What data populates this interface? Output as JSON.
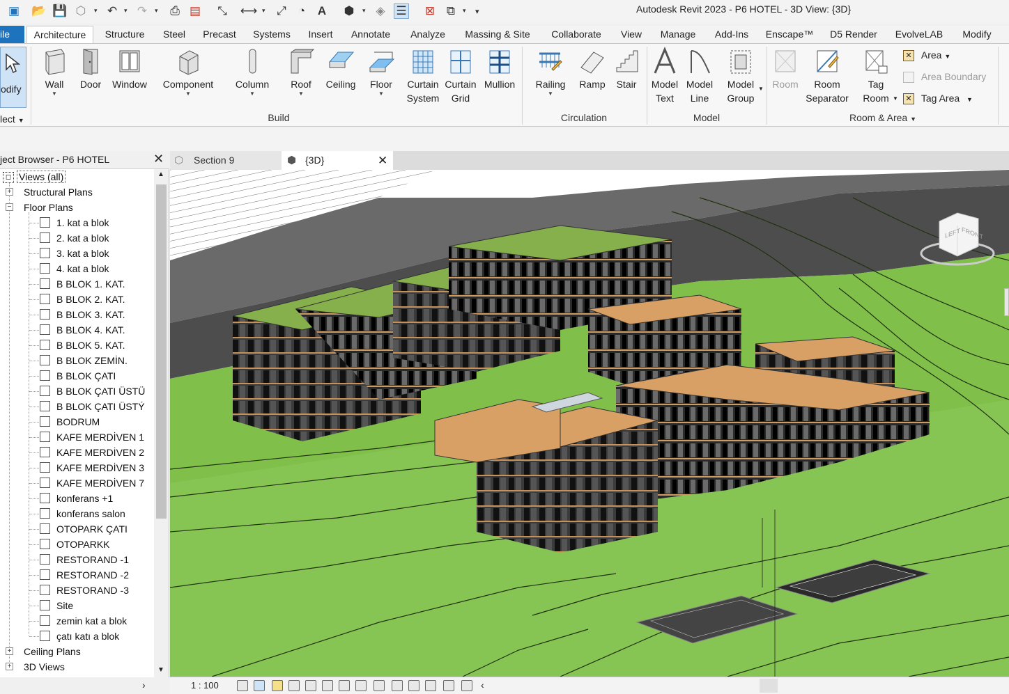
{
  "app": {
    "title": "Autodesk Revit 2023 - P6 HOTEL - 3D View: {3D}"
  },
  "ribbon_tabs": [
    "ile",
    "Architecture",
    "Structure",
    "Steel",
    "Precast",
    "Systems",
    "Insert",
    "Annotate",
    "Analyze",
    "Massing & Site",
    "Collaborate",
    "View",
    "Manage",
    "Add-Ins",
    "Enscape™",
    "D5 Render",
    "EvolveLAB",
    "Modify"
  ],
  "ribbon": {
    "modify_label": "odify",
    "select_label": "lect",
    "build": {
      "title": "Build",
      "wall": "Wall",
      "door": "Door",
      "window": "Window",
      "component": "Component",
      "column": "Column",
      "roof": "Roof",
      "ceiling": "Ceiling",
      "floor": "Floor",
      "curtain_system_1": "Curtain",
      "curtain_system_2": "System",
      "curtain_grid_1": "Curtain",
      "curtain_grid_2": "Grid",
      "mullion": "Mullion"
    },
    "circulation": {
      "title": "Circulation",
      "railing": "Railing",
      "ramp": "Ramp",
      "stair": "Stair"
    },
    "model": {
      "title": "Model",
      "model_text_1": "Model",
      "model_text_2": "Text",
      "model_line_1": "Model",
      "model_line_2": "Line",
      "model_group_1": "Model",
      "model_group_2": "Group"
    },
    "room_area": {
      "title": "Room & Area",
      "room": "Room",
      "room_separator_1": "Room",
      "room_separator_2": "Separator",
      "tag_room_1": "Tag",
      "tag_room_2": "Room",
      "area": "Area",
      "area_boundary": "Area  Boundary",
      "tag_area": "Tag  Area"
    }
  },
  "project_browser": {
    "title": "ject Browser - P6 HOTEL",
    "root": "Views (all)",
    "structural_plans": "Structural Plans",
    "floor_plans": "Floor Plans",
    "floor_plan_items": [
      "1. kat a blok",
      "2. kat a blok",
      "3. kat a blok",
      "4. kat a blok",
      "B BLOK 1. KAT.",
      "B BLOK 2. KAT.",
      "B BLOK 3. KAT.",
      "B BLOK 4. KAT.",
      "B BLOK 5. KAT.",
      "B BLOK ZEMİN.",
      "B BLOK ÇATI",
      "B BLOK ÇATI ÜSTÜ",
      "B BLOK ÇATI ÜSTÝ",
      "BODRUM",
      "KAFE MERDİVEN 1",
      "KAFE MERDİVEN 2",
      "KAFE MERDİVEN 3",
      "KAFE MERDİVEN 7",
      "konferans +1",
      "konferans salon",
      "OTOPARK ÇATI",
      "OTOPARKK",
      "RESTORAND -1",
      "RESTORAND -2",
      "RESTORAND -3",
      "Site",
      "zemin kat a blok",
      "çatı katı a blok"
    ],
    "ceiling_plans": "Ceiling Plans",
    "views_3d": "3D Views"
  },
  "view_tabs": {
    "section": "Section 9",
    "active": "{3D}"
  },
  "viewcube": {
    "left": "LEFT",
    "front": "FRONT"
  },
  "view_control_bar": {
    "scale": "1 : 100"
  },
  "colors": {
    "file_tab": "#1e73be",
    "terrain": "#7fbf4a",
    "roof_green": "#86b04c",
    "roof_tan": "#d9a066"
  }
}
